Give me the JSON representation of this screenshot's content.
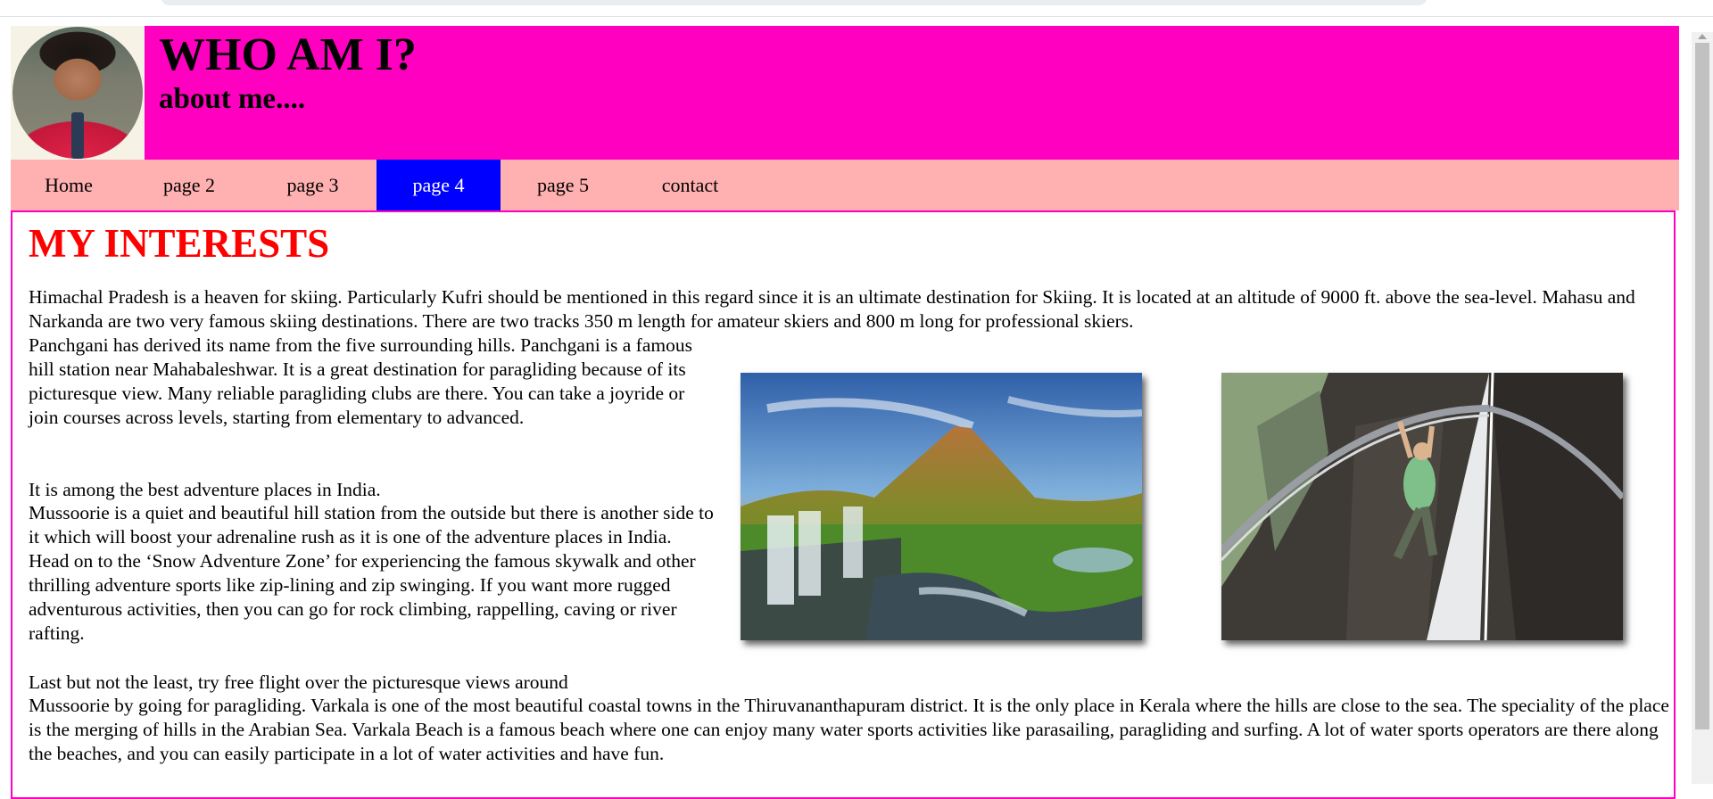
{
  "header": {
    "title": "WHO AM I?",
    "subtitle": "about me...."
  },
  "nav": {
    "items": [
      {
        "label": "Home",
        "active": false
      },
      {
        "label": "page 2",
        "active": false
      },
      {
        "label": "page 3",
        "active": false
      },
      {
        "label": "page 4",
        "active": true
      },
      {
        "label": "page 5",
        "active": false
      },
      {
        "label": "contact",
        "active": false
      }
    ]
  },
  "main": {
    "heading": "MY INTERESTS",
    "paragraphs": [
      "Himachal Pradesh is a heaven for skiing. Particularly Kufri should be mentioned in this regard since it is an ultimate destination for Skiing. It is located at an altitude of 9000 ft. above the sea-level. Mahasu and Narkanda are two very famous skiing destinations. There are two tracks 350 m length for amateur skiers and 800 m long for professional skiers.",
      "Panchgani has derived its name from the five surrounding hills. Panchgani is a famous hill station near Mahabaleshwar. It is a great destination for paragliding because of its picturesque view. Many reliable paragliding clubs are there. You can take a joyride or join courses across levels, starting from elementary to advanced.",
      "It is among the best adventure places in India.",
      "Mussoorie is a quiet and beautiful hill station from the outside but there is another side to it which will boost your adrenaline rush as it is one of the adventure places in India. Head on to the ‘Snow Adventure Zone’ for experiencing the famous skywalk and other thrilling adventure sports like zip-lining and zip swinging. If you want more rugged adventurous activities, then you can go for rock climbing, rappelling, caving or river rafting.",
      "Last but not the least, try free flight over the picturesque views around",
      "Mussoorie by going for paragliding. Varkala is one of the most beautiful coastal towns in the Thiruvananthapuram district. It is the only place in Kerala where the hills are close to the sea. The speciality of the place is the merging of hills in the Arabian Sea. Varkala Beach is a famous beach where one can enjoy many water sports activities like parasailing, paragliding and surfing. A lot of water sports operators are there along the beaches, and you can easily participate in a lot of water activities and have fun."
    ]
  },
  "colors": {
    "header_bg": "#ff00c0",
    "nav_bg": "#ffb0b0",
    "nav_active_bg": "#0000ff",
    "heading": "#ff0000"
  }
}
